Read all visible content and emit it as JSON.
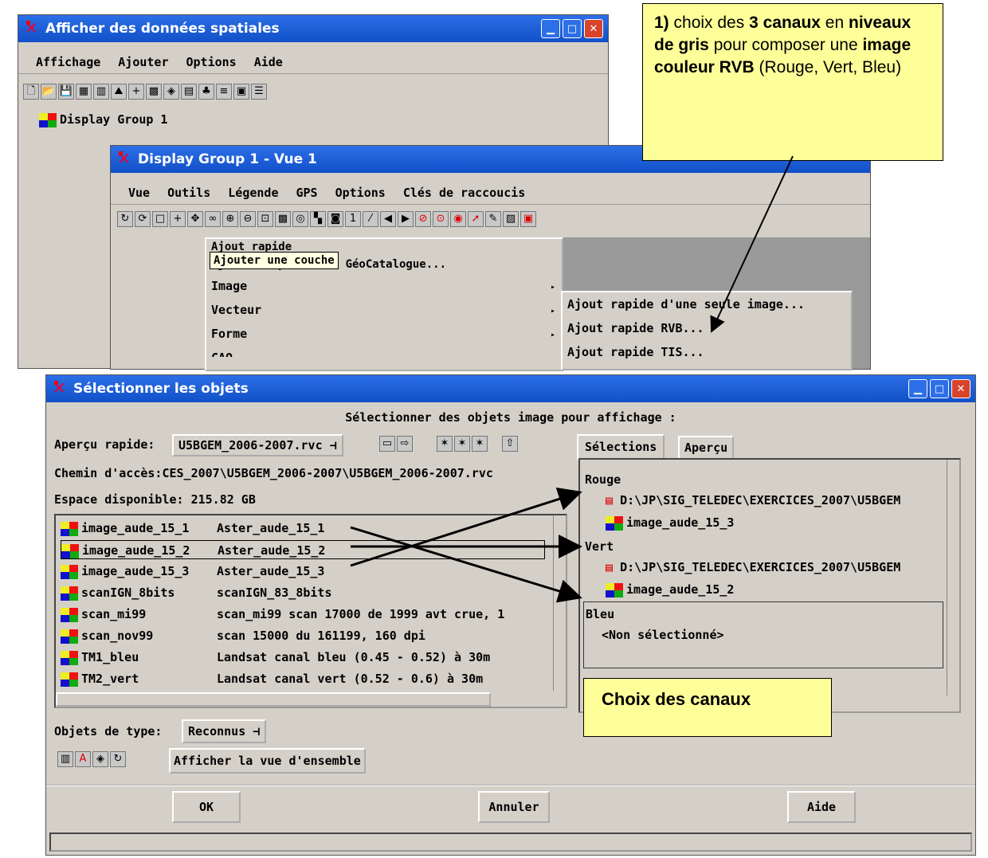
{
  "win1": {
    "title": "Afficher des données spatiales",
    "menu": [
      "Affichage",
      "Ajouter",
      "Options",
      "Aide"
    ],
    "group": "Display Group 1"
  },
  "win2": {
    "title": "Display Group 1 - Vue 1",
    "menu": [
      "Vue",
      "Outils",
      "Légende",
      "GPS",
      "Options",
      "Clés de raccoucis"
    ],
    "dropdown": [
      "Ajout rapide",
      "Ajouter à partir du GéoCatalogue...",
      "Image",
      "Vecteur",
      "Forme",
      "CAO"
    ],
    "tooltip": "Ajouter une couche",
    "submenu": [
      "Ajout rapide d'une seule image...",
      "Ajout rapide RVB...",
      "Ajout rapide TIS..."
    ]
  },
  "win3": {
    "title": "Sélectionner les objets",
    "header": "Sélectionner des objets image pour affichage :",
    "apercu_label": "Aperçu rapide:",
    "apercu_value": "U5BGEM_2006-2007.rvc",
    "tabs": [
      "Sélections",
      "Aperçu"
    ],
    "chemin_label": "Chemin d'accès:",
    "chemin_value": "CES_2007\\U5BGEM_2006-2007\\U5BGEM_2006-2007.rvc",
    "espace_label": "Espace disponible:",
    "espace_value": "215.82 GB",
    "items": [
      {
        "name": "image_aude_15_1",
        "desc": "Aster_aude_15_1"
      },
      {
        "name": "image_aude_15_2",
        "desc": "Aster_aude_15_2"
      },
      {
        "name": "image_aude_15_3",
        "desc": "Aster_aude_15_3"
      },
      {
        "name": "scanIGN_8bits",
        "desc": "scanIGN_83_8bits"
      },
      {
        "name": "scan_mi99",
        "desc": "scan_mi99 scan 17000 de 1999 avt crue, 1"
      },
      {
        "name": "scan_nov99",
        "desc": "scan 15000 du 161199, 160 dpi"
      },
      {
        "name": "TM1_bleu",
        "desc": "Landsat canal bleu (0.45 - 0.52) à 30m"
      },
      {
        "name": "TM2_vert",
        "desc": "Landsat canal vert (0.52 - 0.6) à 30m"
      }
    ],
    "sel": {
      "rouge": "Rouge",
      "vert": "Vert",
      "bleu": "Bleu",
      "path": "D:\\JP\\SIG_TELEDEC\\EXERCICES_2007\\U5BGEM",
      "rouge_img": "image_aude_15_3",
      "vert_img": "image_aude_15_2",
      "bleu_none": "<Non sélectionné>"
    },
    "type_label": "Objets de type:",
    "type_value": "Reconnus",
    "overview_btn": "Afficher la vue d'ensemble",
    "ok": "OK",
    "cancel": "Annuler",
    "help": "Aide"
  },
  "note1": {
    "p1": "1)",
    "p2": " choix des ",
    "p3": "3 canaux",
    "p4": "  en ",
    "p5": "niveaux de gris",
    "p6": "  pour composer une ",
    "p7": "image couleur RVB",
    "p8": "  (Rouge, Vert, Bleu)"
  },
  "note2": "Choix des canaux"
}
